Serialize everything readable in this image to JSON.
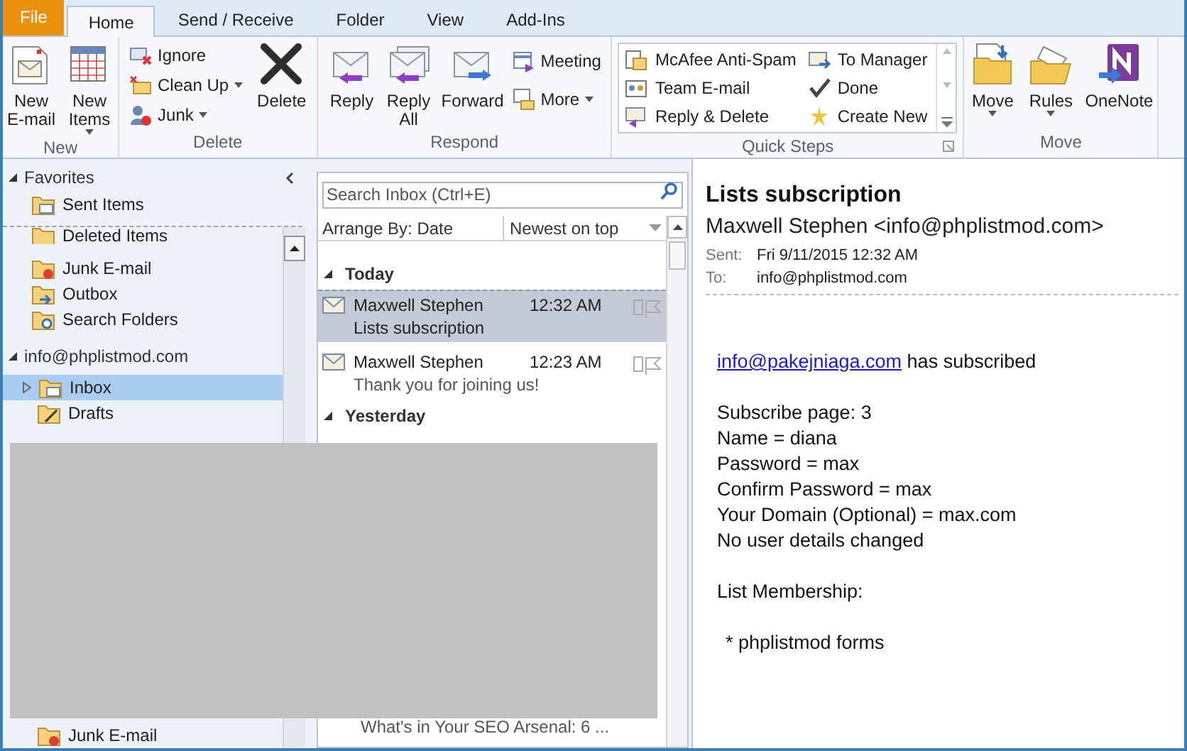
{
  "ribbon_tabs": [
    {
      "label": "File",
      "kind": "file",
      "selected": false
    },
    {
      "label": "Home",
      "kind": "tab",
      "selected": true
    },
    {
      "label": "Send / Receive",
      "kind": "tab",
      "selected": false
    },
    {
      "label": "Folder",
      "kind": "tab",
      "selected": false
    },
    {
      "label": "View",
      "kind": "tab",
      "selected": false
    },
    {
      "label": "Add-Ins",
      "kind": "tab",
      "selected": false
    }
  ],
  "ribbon_groups": [
    {
      "kind": "new",
      "title": "New",
      "large": [
        {
          "lines": [
            "New",
            "E-mail"
          ],
          "dropdown": false
        },
        {
          "lines": [
            "New",
            "Items"
          ],
          "dropdown": true
        }
      ]
    },
    {
      "kind": "delete",
      "title": "Delete",
      "small": [
        {
          "label": "Ignore",
          "dropdown": false
        },
        {
          "label": "Clean Up",
          "dropdown": true
        },
        {
          "label": "Junk",
          "dropdown": true
        }
      ],
      "large": [
        {
          "lines": [
            "Delete"
          ],
          "dropdown": false
        }
      ]
    },
    {
      "kind": "respond",
      "title": "Respond",
      "large": [
        {
          "lines": [
            "Reply"
          ],
          "dropdown": false
        },
        {
          "lines": [
            "Reply",
            "All"
          ],
          "dropdown": false
        },
        {
          "lines": [
            "Forward"
          ],
          "dropdown": false
        }
      ],
      "small": [
        {
          "label": "Meeting",
          "dropdown": false
        },
        {
          "label": "More",
          "dropdown": true
        }
      ]
    },
    {
      "kind": "quick_steps",
      "title": "Quick Steps",
      "steps": [
        "McAfee Anti-Spam",
        "To Manager",
        "Team E-mail",
        "Done",
        "Reply & Delete",
        "Create New"
      ]
    },
    {
      "kind": "move",
      "title": "Move",
      "large": [
        {
          "lines": [
            "Move"
          ],
          "dropdown": true
        },
        {
          "lines": [
            "Rules"
          ],
          "dropdown": true
        },
        {
          "lines": [
            "OneNote"
          ],
          "dropdown": false
        }
      ]
    }
  ],
  "nav": {
    "favorites": {
      "label": "Favorites",
      "expanded": true,
      "children": [
        {
          "label": "Sent Items",
          "selected": false
        }
      ]
    },
    "folders": [
      {
        "label": "Deleted Items",
        "selected": false
      },
      {
        "label": "Junk E-mail",
        "selected": false
      },
      {
        "label": "Outbox",
        "selected": false
      },
      {
        "label": "Search Folders",
        "selected": false
      }
    ],
    "account": {
      "label": "info@phplistmod.com",
      "expanded": true,
      "children": [
        {
          "label": "Inbox",
          "selected": true,
          "expanded": false
        },
        {
          "label": "Drafts",
          "selected": false
        },
        {
          "label": "Junk E-mail",
          "selected": false
        }
      ]
    }
  },
  "message_list": {
    "search": {
      "placeholder": "Search Inbox (Ctrl+E)"
    },
    "arrange": "Arrange By: Date",
    "sort": "Newest on top",
    "groups": [
      {
        "label": "Today",
        "expanded": true,
        "messages": [
          {
            "sender": "Maxwell Stephen",
            "time": "12:32 AM",
            "subject": "Lists subscription",
            "selected": true
          },
          {
            "sender": "Maxwell Stephen",
            "time": "12:23 AM",
            "subject": "Thank you for joining us!",
            "selected": false
          }
        ]
      },
      {
        "label": "Yesterday",
        "expanded": true,
        "messages": [
          {
            "subject": "What's in Your SEO Arsenal: 6 ...",
            "selected": false
          }
        ]
      }
    ]
  },
  "reading_pane": {
    "subject": "Lists subscription",
    "from": "Maxwell Stephen <info@phplistmod.com>",
    "sent_label": "Sent:",
    "sent": "Fri 9/11/2015 12:32 AM",
    "to_label": "To:",
    "to": "info@phplistmod.com",
    "intro": {
      "link": "info@pakejniaga.com",
      "text": "has subscribed"
    },
    "paragraphs": [
      {
        "kind": "plain",
        "lines": [
          "Subscribe page: 3",
          "Name = diana",
          "Password = max",
          "Confirm Password = max",
          "Your Domain (Optional) = max.com",
          "No user details changed"
        ]
      },
      {
        "kind": "plain",
        "lines": [
          "List Membership:"
        ]
      },
      {
        "kind": "bullet",
        "lines": [
          "* phplistmod forms"
        ]
      }
    ]
  }
}
